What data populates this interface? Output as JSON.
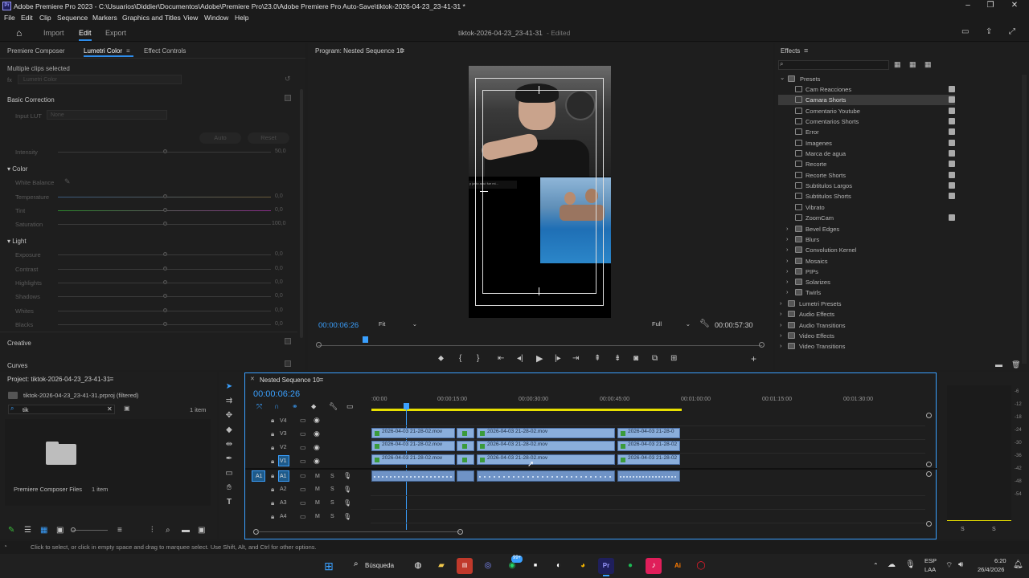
{
  "window": {
    "title": "Adobe Premiere Pro 2023 - C:\\Usuarios\\Diddier\\Documentos\\Adobe\\Premiere Pro\\23.0\\Adobe Premiere Pro Auto-Save\\tiktok-2026-04-23_23-41-31 *",
    "logo_text": "Pr"
  },
  "menu": [
    "File",
    "Edit",
    "Clip",
    "Sequence",
    "Markers",
    "Graphics and Titles",
    "View",
    "Window",
    "Help"
  ],
  "header": {
    "tabs": [
      "Import",
      "Edit",
      "Export"
    ],
    "active_tab": "Edit",
    "project_name": "tiktok-2026-04-23_23-41-31",
    "status": "Edited"
  },
  "left_panel": {
    "tabs": [
      "Premiere Composer",
      "Lumetri Color",
      "Effect Controls"
    ],
    "active_tab": "Lumetri Color",
    "clips_selected": "Multiple clips selected",
    "fx_value": "Lumetri Color",
    "sections": {
      "basic": "Basic Correction",
      "input_lut_label": "Input LUT",
      "input_lut_value": "None",
      "auto": "Auto",
      "reset": "Reset",
      "intensity": "Intensity",
      "intensity_val": "50,0",
      "color": "Color",
      "white_balance": "White Balance",
      "temperature": "Temperature",
      "tint": "Tint",
      "saturation": "Saturation",
      "temp_val": "0,0",
      "tint_val": "0,0",
      "sat_val": "100,0",
      "light": "Light",
      "exposure": "Exposure",
      "contrast": "Contrast",
      "highlights": "Highlights",
      "shadows": "Shadows",
      "whites": "Whites",
      "blacks": "Blacks",
      "zero": "0,0",
      "creative": "Creative",
      "curves": "Curves"
    }
  },
  "program": {
    "title": "Program: Nested Sequence 10",
    "timecode": "00:00:06:26",
    "fit": "Fit",
    "quality": "Full",
    "duration": "00:00:57:30",
    "video_caption": "y justo aquí fue mi..."
  },
  "effects": {
    "title": "Effects",
    "presets_label": "Presets",
    "presets": [
      "Cam Reacciones",
      "Camara Shorts",
      "Comentario Youtube",
      "Comentarios Shorts",
      "Error",
      "Imagenes",
      "Marca de agua",
      "Recorte",
      "Recorte Shorts",
      "Subtitulos Largos",
      "Subtitulos Shorts",
      "Vibrato",
      "ZoomCam",
      "Bevel Edges",
      "Blurs",
      "Convolution Kernel",
      "Mosaics",
      "PIPs",
      "Solarizes",
      "Twirls"
    ],
    "selected": "Camara Shorts",
    "categories": [
      "Lumetri Presets",
      "Audio Effects",
      "Audio Transitions",
      "Video Effects",
      "Video Transitions"
    ]
  },
  "project": {
    "title": "Project: tiktok-2026-04-23_23-41-31",
    "file": "tiktok-2026-04-23_23-41-31.prproj (filtered)",
    "search_value": "tik",
    "item_count": "1 item",
    "bin_name": "Premiere Composer Files",
    "bin_count": "1 item"
  },
  "timeline": {
    "title": "Nested Sequence 10",
    "timecode": "00:00:06:26",
    "ruler": [
      ":00:00",
      "00:00:15:00",
      "00:00:30:00",
      "00:00:45:00",
      "00:01:00:00",
      "00:01:15:00",
      "00:01:30:00"
    ],
    "video_tracks": [
      "V4",
      "V3",
      "V2",
      "V1"
    ],
    "audio_tracks": [
      "A1",
      "A2",
      "A3",
      "A4"
    ],
    "source_v": "V1",
    "source_a": "A1",
    "clip_name": "2026-04-03 21-28-02.mov",
    "clip_name_short": "2026-04-03 21-28-0",
    "clip_name_mid": "2026-04-03 21-28-02",
    "toggles": {
      "m": "M",
      "s": "S"
    }
  },
  "meters": {
    "scale": [
      "-6",
      "-12",
      "-18",
      "-24",
      "-30",
      "-36",
      "-42",
      "-48",
      "-54"
    ],
    "solo": [
      "S",
      "S"
    ]
  },
  "status_bar": "Click to select, or click in empty space and drag to marquee select. Use Shift, Alt, and Ctrl for other options.",
  "taskbar": {
    "search": "Búsqueda",
    "lang_top": "ESP",
    "lang_bottom": "LAA",
    "time": "6:20",
    "date": "26/4/2026",
    "badge": "99+"
  },
  "colors": {
    "accent": "#2d8ceb",
    "clip_blue": "#8aaedb",
    "playhead": "#3aa0ff",
    "yellow_bar": "#e8e000"
  }
}
